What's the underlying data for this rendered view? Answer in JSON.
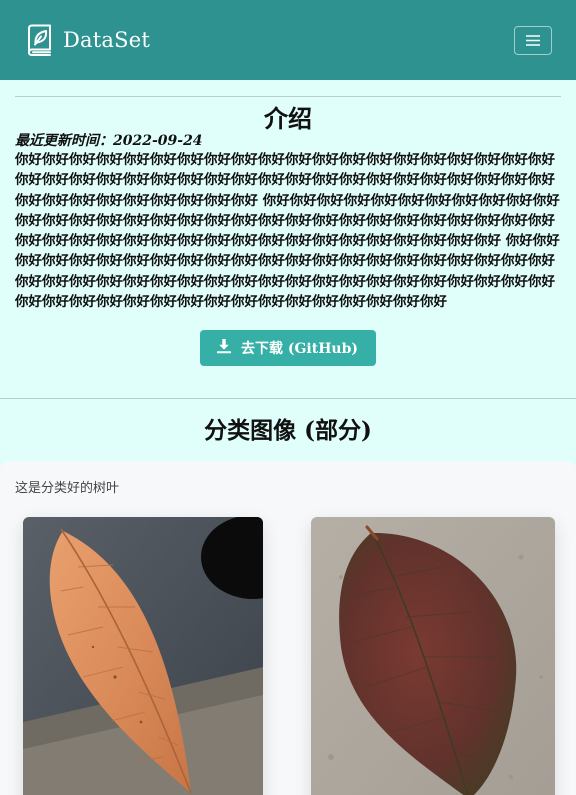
{
  "navbar": {
    "brand": "DataSet",
    "logo_icon": "book-leaf-icon",
    "menu_icon": "hamburger-icon"
  },
  "intro": {
    "title": "介绍",
    "updated": "最近更新时间：2022-09-24",
    "body": "你好你好你好你好你好你好你好你好你好你好你好你好你好你好你好你好你好你好你好你好你好你好你好你好你好你好你好你好你好你好你好你好你好你好你好你好你好你好你好你好你好你好你好你好你好你好你好你好你好 你好你好你好你好你好你好你好你好你好你好你好你好你好你好你好你好你好你好你好你好你好你好你好你好你好你好你好你好你好你好你好你好你好你好你好你好你好你好你好你好你好你好你好你好你好你好你好你好你好 你好你好你好你好你好你好你好你好你好你好你好你好你好你好你好你好你好你好你好你好你好你好你好你好你好你好你好你好你好你好你好你好你好你好你好你好你好你好你好你好你好你好你好你好你好你好你好你好你好你好你好你好你好你好你好你好你好你好",
    "download_label": "去下载 (GitHub)",
    "download_icon": "download-icon"
  },
  "gallery": {
    "title": "分类图像 (部分)",
    "card_desc": "这是分类好的树叶"
  },
  "colors": {
    "navbar": "#2e9390",
    "button": "#36afa7",
    "page_bg": "#e0fffb"
  }
}
